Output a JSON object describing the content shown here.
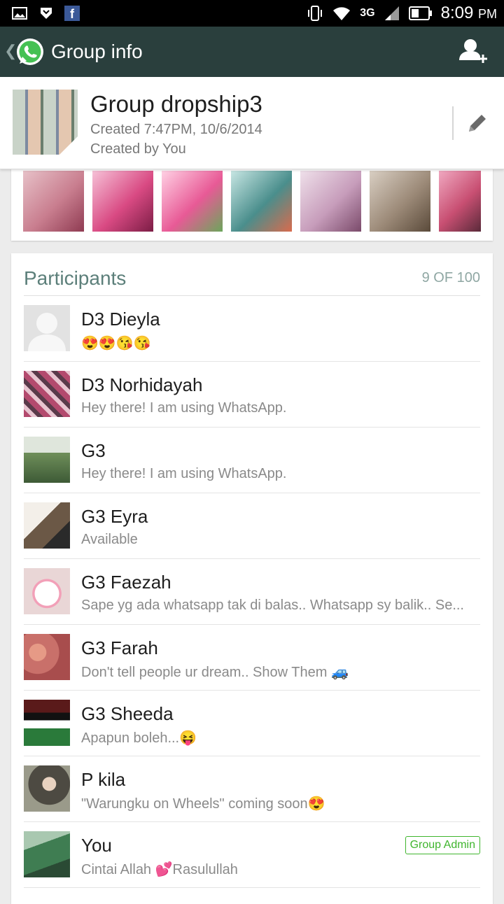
{
  "status_bar": {
    "time": "8:09",
    "ampm": "PM",
    "network": "3G",
    "icons": [
      "gallery-icon",
      "shield-icon",
      "facebook-icon",
      "vibrate-icon",
      "wifi-icon",
      "signal-icon",
      "battery-icon"
    ]
  },
  "appbar": {
    "title": "Group info",
    "back_icon": "chevron-left-icon",
    "logo_icon": "whatsapp-icon",
    "add_participant_icon": "add-user-icon"
  },
  "group": {
    "name": "Group dropship3",
    "created": "Created 7:47PM, 10/6/2014",
    "created_by": "Created by You",
    "edit_icon": "pencil-icon"
  },
  "media": {
    "thumbs": [
      {
        "name": "media-thumb-1",
        "color": "#c97e8f"
      },
      {
        "name": "media-thumb-2",
        "color": "#d94a83"
      },
      {
        "name": "media-thumb-3",
        "color": "#e85a96"
      },
      {
        "name": "media-thumb-4",
        "color": "#4a8e8c"
      },
      {
        "name": "media-thumb-5",
        "color": "#c79dbb"
      },
      {
        "name": "media-thumb-6",
        "color": "#9c8a78"
      },
      {
        "name": "media-thumb-7",
        "color": "#c84f72"
      }
    ]
  },
  "participants": {
    "title": "Participants",
    "count": "9 OF 100",
    "items": [
      {
        "name": "D3 Dieyla",
        "status": "😍😍😘😘",
        "avatar": "#e2e2e2",
        "admin": ""
      },
      {
        "name": "D3 Norhidayah",
        "status": "Hey there! I am using WhatsApp.",
        "avatar": "#b34a6e",
        "admin": ""
      },
      {
        "name": "G3",
        "status": "Hey there! I am using WhatsApp.",
        "avatar": "#6f8f5a",
        "admin": ""
      },
      {
        "name": "G3 Eyra",
        "status": "Available",
        "avatar": "#6b5846",
        "admin": ""
      },
      {
        "name": "G3 Faezah",
        "status": "Sape yg ada whatsapp tak di balas.. Whatsapp sy balik.. Se...",
        "avatar": "#e9d6d6",
        "admin": ""
      },
      {
        "name": "G3 Farah",
        "status": "Don't tell people ur dream.. Show Them 🚙",
        "avatar": "#c9706a",
        "admin": ""
      },
      {
        "name": "G3 Sheeda",
        "status": "Apapun boleh...😝",
        "avatar": "#2a7a3a",
        "admin": ""
      },
      {
        "name": "P kila",
        "status": "\"Warungku on Wheels\" coming soon😍",
        "avatar": "#4d4a42",
        "admin": ""
      },
      {
        "name": "You",
        "status": "Cintai Allah 💕Rasulullah",
        "avatar": "#3f7d52",
        "admin": "Group Admin"
      }
    ]
  },
  "colors": {
    "appbar": "#2a3f3d",
    "accent": "#5c7f7a",
    "admin": "#3fb52d"
  }
}
